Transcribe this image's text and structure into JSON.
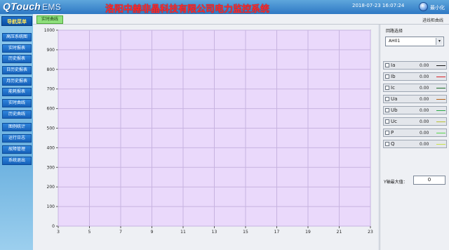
{
  "app": {
    "logo_main": "QTouch",
    "logo_sub": "EMS",
    "system_title": "洛阳中赫非晶科技有限公司电力监控系统",
    "datetime": "2018-07-23 16:07:24",
    "minimize_label": "最小化"
  },
  "sidebar": {
    "header": "导航菜单",
    "items": [
      {
        "label": "高压系统图"
      },
      {
        "label": "实时报表"
      },
      {
        "label": "历史报表"
      },
      {
        "label": "日历史报表"
      },
      {
        "label": "月历史报表"
      },
      {
        "label": "能耗报表"
      },
      {
        "label": "实时曲线"
      },
      {
        "label": "历史曲线"
      },
      {
        "label": "图例统计"
      },
      {
        "label": "运行日志"
      },
      {
        "label": "故障管理"
      },
      {
        "label": "系统退出"
      }
    ]
  },
  "tabbar": {
    "active_tab": "实时曲线",
    "right_label": "进线柜曲线"
  },
  "right_panel": {
    "route_label": "回路选择",
    "route_selected": "AH01",
    "signals": [
      {
        "name": "Ia",
        "value": "0.00",
        "color": "#1a1a1a"
      },
      {
        "name": "Ib",
        "value": "0.00",
        "color": "#d8232a"
      },
      {
        "name": "Ic",
        "value": "0.00",
        "color": "#1f6f2a"
      },
      {
        "name": "Ua",
        "value": "0.00",
        "color": "#b5651d"
      },
      {
        "name": "Ub",
        "value": "0.00",
        "color": "#2ea84a"
      },
      {
        "name": "Uc",
        "value": "0.00",
        "color": "#b8c234"
      },
      {
        "name": "P",
        "value": "0.00",
        "color": "#57d64b"
      },
      {
        "name": "Q",
        "value": "0.00",
        "color": "#c9e24a"
      }
    ],
    "ymax_label": "Y轴最大值：",
    "ymax_value": "0"
  },
  "chart_data": {
    "type": "line",
    "x_ticks": [
      3,
      5,
      7,
      9,
      11,
      13,
      15,
      17,
      19,
      21,
      23
    ],
    "y_ticks": [
      0,
      100,
      200,
      300,
      400,
      500,
      600,
      700,
      800,
      900,
      1000
    ],
    "xlim": [
      3,
      23
    ],
    "ylim": [
      0,
      1000
    ],
    "grid": true,
    "series": [],
    "colors": {
      "plot_bg": "#ead9fb",
      "grid": "#c7b3e0",
      "axis": "#555555"
    }
  }
}
